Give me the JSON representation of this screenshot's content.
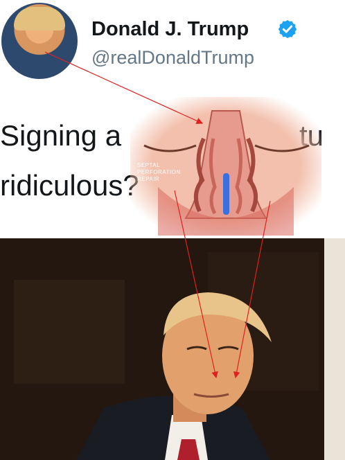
{
  "profile": {
    "display_name": "Donald J. Trump",
    "handle": "@realDonaldTrump",
    "verified_icon": "verified-badge-icon",
    "verified_color": "#1da1f2"
  },
  "tweet": {
    "line1_start": "Signing a",
    "line1_end": "tu",
    "line2": "ridiculous?"
  },
  "overlay": {
    "label_lines": [
      "SEPTAL",
      "PERFORATION",
      "REPAIR"
    ]
  },
  "colors": {
    "arrow": "#e02020",
    "name_text": "#14171a",
    "handle_text": "#657786"
  }
}
